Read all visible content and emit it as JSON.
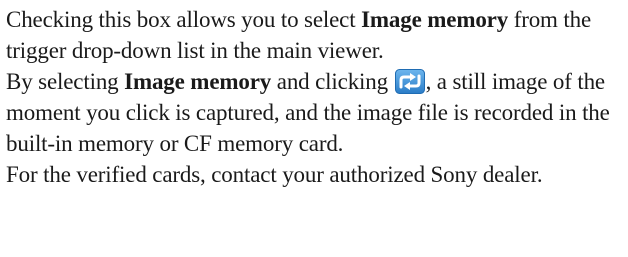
{
  "paragraph1": {
    "part1": "Checking this box allows you to select ",
    "bold1": "Image memory",
    "part2": " from the trigger drop-down list in the main viewer."
  },
  "paragraph2": {
    "part1": "By selecting ",
    "bold1": "Image memory",
    "part2": " and clicking ",
    "icon": "capture-arrow-icon",
    "part3": ", a still image of the moment you click is captured, and the image file is recorded in the built-in memory or CF memory card."
  },
  "paragraph3": {
    "text": "For the verified cards, contact your authorized Sony dealer."
  },
  "colors": {
    "icon_background": "#3a8fd6",
    "icon_arrow": "#ffffff"
  }
}
